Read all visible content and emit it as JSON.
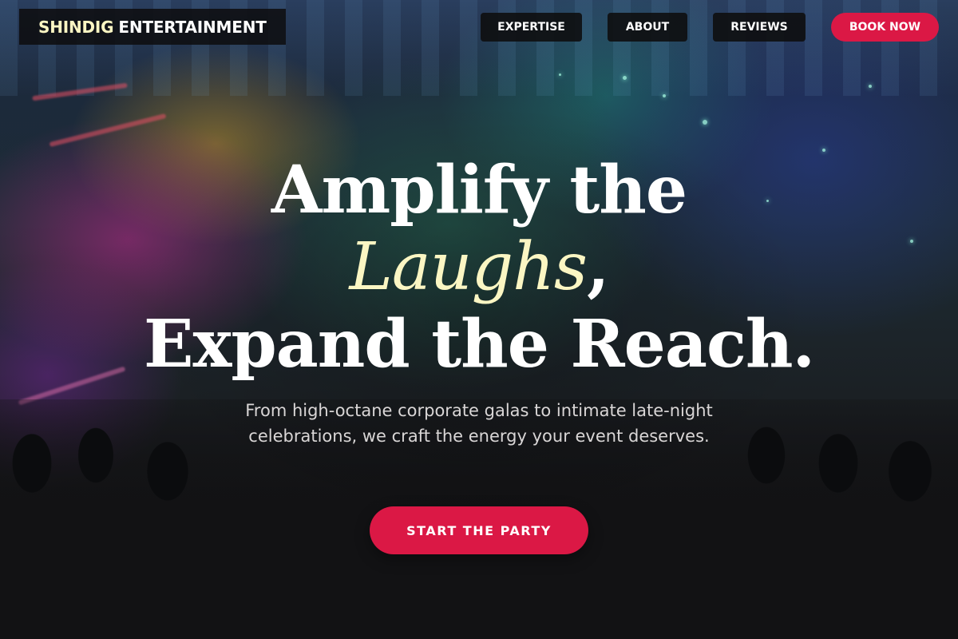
{
  "header": {
    "logo": {
      "accent_word": "SHINDIG",
      "rest": "ENTERTAINMENT"
    },
    "nav": {
      "expertise": "EXPERTISE",
      "about": "ABOUT",
      "reviews": "REVIEWS",
      "book_now": "BOOK NOW"
    }
  },
  "hero": {
    "headline": {
      "line1": "Amplify the",
      "accent_word": "Laughs",
      "accent_punctuation": ",",
      "line3": "Expand the Reach."
    },
    "subtitle": "From high-octane corporate galas to intimate late-night celebrations, we craft the energy your event deserves.",
    "cta_label": "START THE PARTY"
  },
  "colors": {
    "accent_red": "#db1845",
    "accent_cream": "#fbf6c3",
    "nav_bg": "#0e0e10",
    "text_light": "#d9d6d6"
  }
}
